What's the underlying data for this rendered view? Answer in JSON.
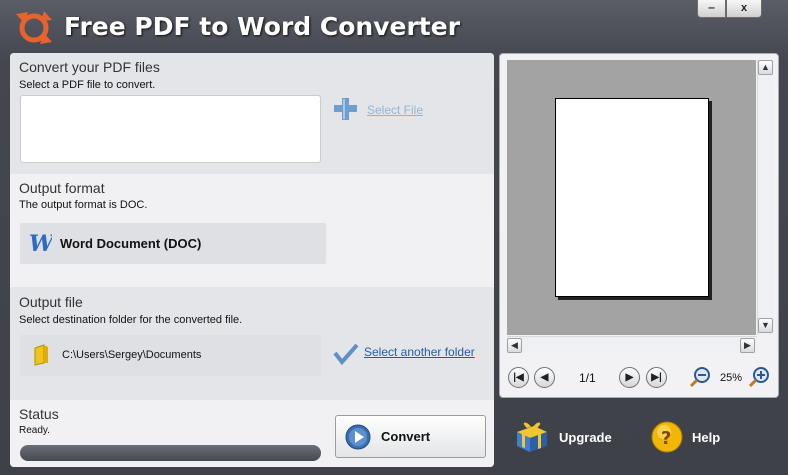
{
  "window": {
    "title": "Free PDF to Word Converter",
    "minimize_glyph": "‒",
    "close_glyph": "x"
  },
  "input_section": {
    "title": "Convert your PDF files",
    "subtitle": "Select a PDF file to convert.",
    "select_link": "Select File"
  },
  "format_section": {
    "title": "Output format",
    "subtitle": "The output format is DOC.",
    "format_label": "Word Document (DOC)",
    "format_icon_letter": "W"
  },
  "output_section": {
    "title": "Output file",
    "subtitle": "Select destination folder for the converted file.",
    "folder_path": "C:\\Users\\Sergey\\Documents",
    "another_folder_link": "Select another folder"
  },
  "status_section": {
    "title": "Status",
    "status_text": "Ready.",
    "progress": 0,
    "convert_label": "Convert"
  },
  "preview": {
    "page_indicator": "1/1",
    "zoom_level": "25%"
  },
  "footer": {
    "upgrade_label": "Upgrade",
    "help_label": "Help"
  },
  "icons": {
    "app_logo": "refresh-arrows-icon",
    "select_file": "plus-icon",
    "format": "word-icon",
    "folder": "folder-icon",
    "another_folder": "checkmark-icon",
    "convert": "play-icon",
    "first_page": "first-page-icon",
    "prev_page": "prev-page-icon",
    "next_page": "next-page-icon",
    "last_page": "last-page-icon",
    "zoom_out": "zoom-out-icon",
    "zoom_in": "zoom-in-icon",
    "upgrade": "gift-box-icon",
    "help": "help-icon"
  },
  "colors": {
    "link_light": "#8fb6d9",
    "link": "#1f5fa8",
    "accent_orange": "#e8632b",
    "help_yellow": "#f2b705"
  }
}
